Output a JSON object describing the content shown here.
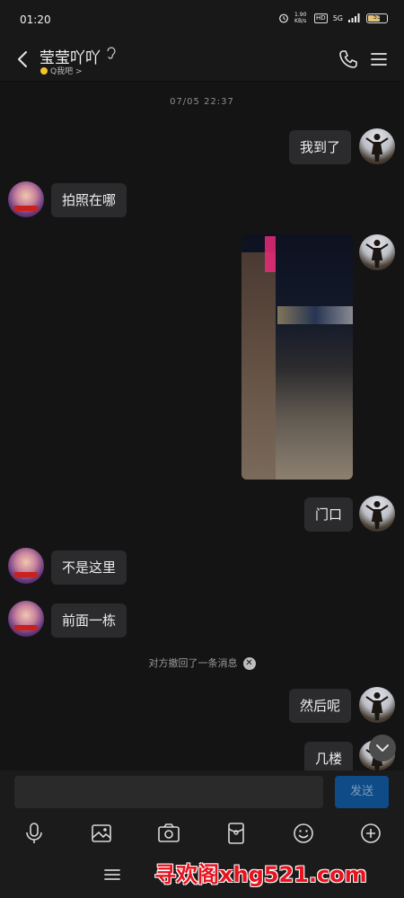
{
  "status_bar": {
    "time": "01:20",
    "network": "5G",
    "hd": "HD",
    "speed": "1.90 KB/s",
    "battery": "55",
    "icons": [
      "alarm-icon",
      "hd-icon",
      "signal-icon",
      "battery-icon"
    ]
  },
  "header": {
    "contact_name": "莹莹吖吖",
    "ear_icon": "earpiece-icon",
    "status": "Q我吧 >",
    "status_dot_color": "#f4c430",
    "icons": [
      "back-icon",
      "phone-icon",
      "menu-icon"
    ]
  },
  "chat": {
    "timestamp": "07/05 22:37",
    "messages": [
      {
        "side": "me",
        "type": "text",
        "text": "我到了"
      },
      {
        "side": "her",
        "type": "text",
        "text": "拍照在哪"
      },
      {
        "side": "me",
        "type": "image",
        "description": ""
      },
      {
        "side": "me",
        "type": "text",
        "text": "门口"
      },
      {
        "side": "her",
        "type": "text",
        "text": "不是这里"
      },
      {
        "side": "her",
        "type": "text",
        "text": "前面一栋"
      },
      {
        "side": "system",
        "type": "notice",
        "text": "对方撤回了一条消息"
      },
      {
        "side": "me",
        "type": "text",
        "text": "然后呢"
      },
      {
        "side": "me",
        "type": "text",
        "text": "几楼"
      }
    ]
  },
  "input": {
    "placeholder": "",
    "send_label": "发送"
  },
  "toolbar": {
    "items": [
      "voice-icon",
      "image-icon",
      "camera-icon",
      "red-packet-icon",
      "emoji-icon",
      "plus-icon"
    ]
  },
  "watermark": "寻欢阁xhg521.com",
  "colors": {
    "background": "#141414",
    "bubble": "#2b2b2d",
    "send_button": "#0f4b86",
    "watermark": "#e8131f"
  }
}
